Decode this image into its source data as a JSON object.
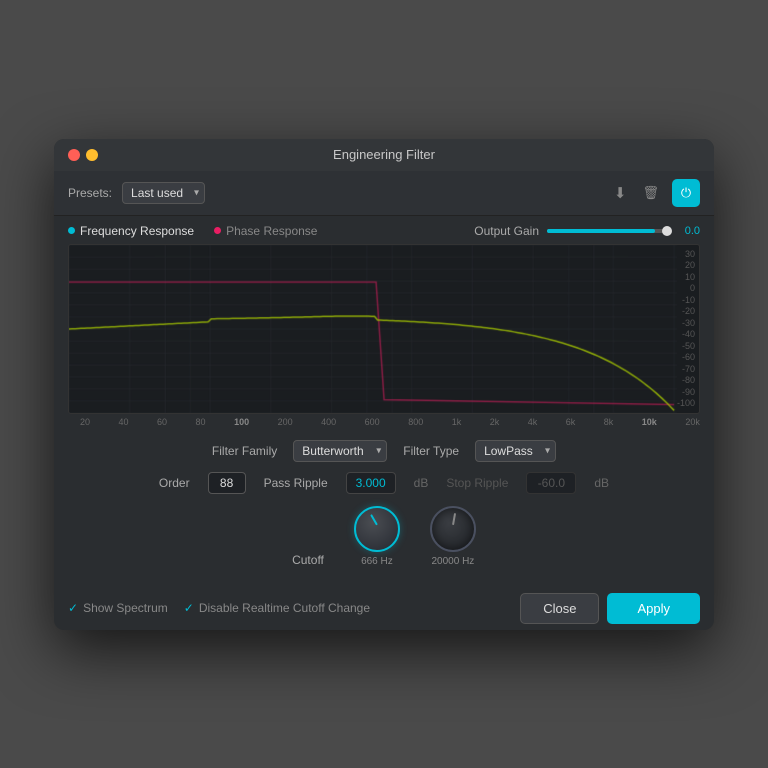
{
  "window": {
    "title": "Engineering Filter"
  },
  "toolbar": {
    "presets_label": "Presets:",
    "preset_value": "Last used",
    "download_icon": "⬇",
    "trash_icon": "🗑",
    "power_icon": "⏻"
  },
  "graph": {
    "freq_response_tab": "Frequency Response",
    "phase_response_tab": "Phase Response",
    "output_gain_label": "Output Gain",
    "gain_value": "0.0",
    "db_labels": [
      "30",
      "20",
      "10",
      "0",
      "-10",
      "-20",
      "-30",
      "-40",
      "-50",
      "-60",
      "-70",
      "-80",
      "-90",
      "-100"
    ],
    "freq_labels": [
      "20",
      "40",
      "60",
      "80",
      "100",
      "200",
      "400",
      "600",
      "800",
      "1k",
      "2k",
      "4k",
      "6k",
      "8k",
      "10k",
      "20k"
    ]
  },
  "filter": {
    "family_label": "Filter Family",
    "family_value": "Butterworth",
    "type_label": "Filter Type",
    "type_value": "LowPass",
    "order_label": "Order",
    "order_value": "88",
    "pass_ripple_label": "Pass Ripple",
    "pass_ripple_value": "3.000",
    "stop_ripple_label": "Stop Ripple",
    "stop_ripple_value": "-60.0",
    "db_unit": "dB"
  },
  "cutoff": {
    "label": "Cutoff",
    "value1": "666 Hz",
    "value2": "20000 Hz"
  },
  "checkboxes": {
    "show_spectrum": "Show Spectrum",
    "disable_realtime": "Disable Realtime Cutoff Change"
  },
  "buttons": {
    "close": "Close",
    "apply": "Apply"
  }
}
